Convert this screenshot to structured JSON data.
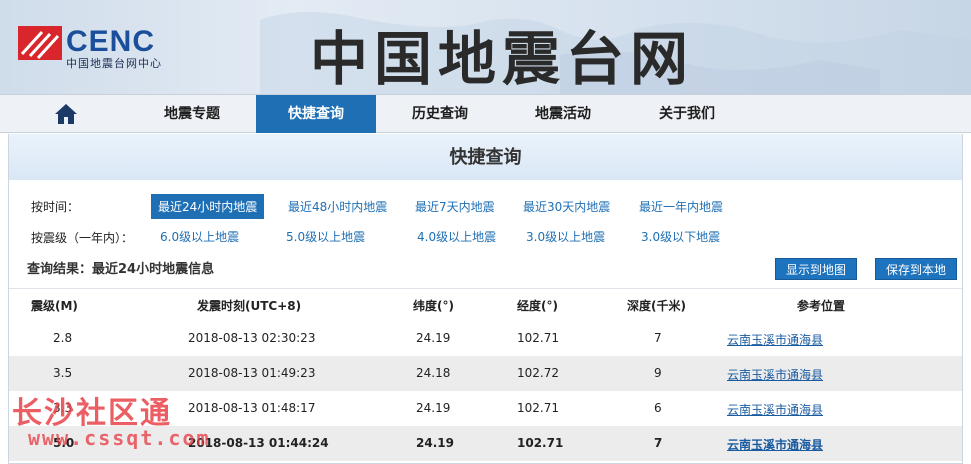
{
  "header": {
    "logo_text": "CENC",
    "logo_sub": "中国地震台网中心",
    "site_title": "中国地震台网"
  },
  "nav": {
    "items": [
      "地震专题",
      "快捷查询",
      "历史查询",
      "地震活动",
      "关于我们"
    ],
    "active": "快捷查询"
  },
  "panel": {
    "title": "快捷查询",
    "time_label": "按时间：",
    "time_options": [
      "最近24小时内地震",
      "最近48小时内地震",
      "最近7天内地震",
      "最近30天内地震",
      "最近一年内地震"
    ],
    "mag_label": "按震级（一年内）：",
    "mag_options": [
      "6.0级以上地震",
      "5.0级以上地震",
      "4.0级以上地震",
      "3.0级以上地震",
      "3.0级以下地震"
    ],
    "result_label": "查询结果：最近24小时地震信息",
    "show_map_button": "显示到地图",
    "save_button": "保存到本地"
  },
  "table": {
    "headers": [
      "震级(M)",
      "发震时刻(UTC+8)",
      "纬度(°)",
      "经度(°)",
      "深度(千米)",
      "参考位置"
    ],
    "rows": [
      [
        "2.8",
        "2018-08-13 02:30:23",
        "24.19",
        "102.71",
        "7",
        "云南玉溪市通海县"
      ],
      [
        "3.5",
        "2018-08-13 01:49:23",
        "24.18",
        "102.72",
        "9",
        "云南玉溪市通海县"
      ],
      [
        "3.3",
        "2018-08-13 01:48:17",
        "24.19",
        "102.71",
        "6",
        "云南玉溪市通海县"
      ],
      [
        "5.0",
        "2018-08-13 01:44:24",
        "24.19",
        "102.71",
        "7",
        "云南玉溪市通海县"
      ]
    ]
  },
  "watermark": {
    "line1": "长沙社区通",
    "line2": "www.cssqt.com"
  },
  "colors": {
    "accent": "#1f6fb5",
    "logo_red": "#d8262c",
    "logo_blue": "#1b4f9c",
    "watermark": "#e8434a"
  }
}
